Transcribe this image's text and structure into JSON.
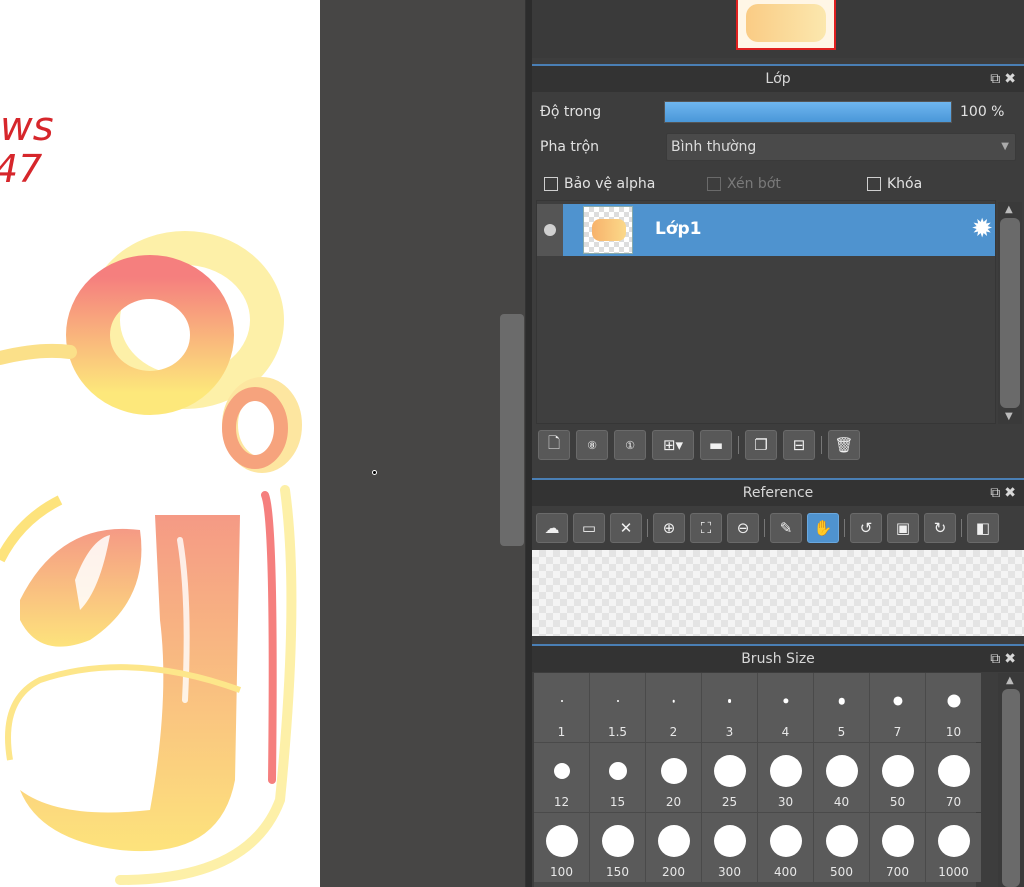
{
  "layer_panel": {
    "title": "Lớp",
    "opacity_label": "Độ trong",
    "opacity_percent": 100,
    "opacity_value": "100 %",
    "blend_label": "Pha trộn",
    "blend_value": "Bình thường",
    "checkboxes": {
      "alpha_protect": "Bảo vệ alpha",
      "clipping": "Xén bớt",
      "lock": "Khóa"
    },
    "layers": [
      {
        "name": "Lớp1"
      }
    ]
  },
  "reference_panel": {
    "title": "Reference"
  },
  "brush_size_panel": {
    "title": "Brush Size",
    "sizes": [
      "1",
      "1.5",
      "2",
      "3",
      "4",
      "5",
      "7",
      "10",
      "12",
      "15",
      "20",
      "25",
      "30",
      "40",
      "50",
      "70",
      "100",
      "150",
      "200",
      "300",
      "400",
      "500",
      "700",
      "1000"
    ]
  },
  "canvas": {
    "handwriting": "ws\n47"
  },
  "colors": {
    "accent": "#4f93cf",
    "panel_bg": "#3d3d3d",
    "title_bg": "#333333",
    "ink_red": "#d6262b"
  }
}
